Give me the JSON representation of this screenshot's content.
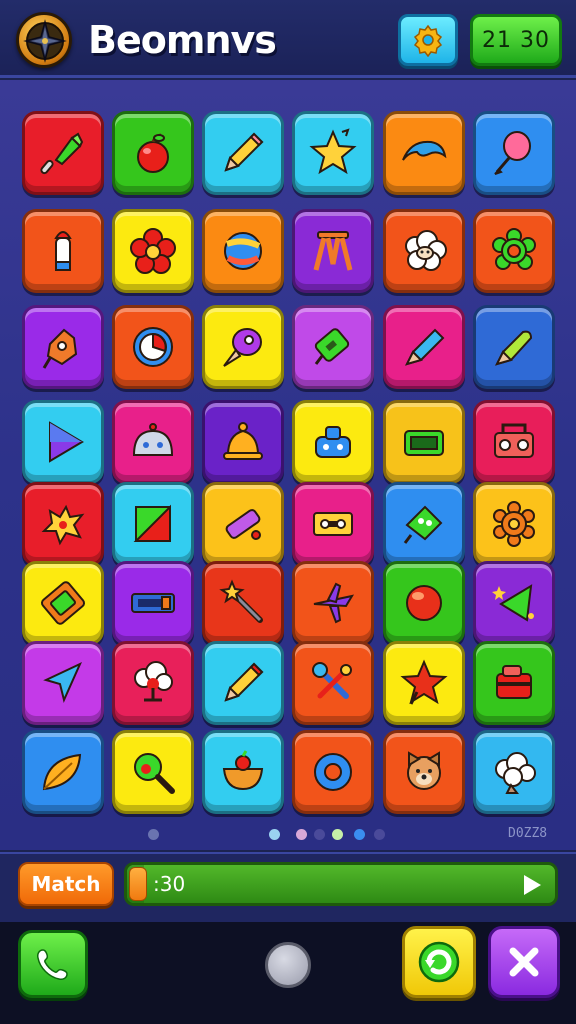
{
  "header": {
    "title": "Beomnvs",
    "timer": "21  30",
    "logo_icon": "compass-icon",
    "settings_icon": "gear-icon"
  },
  "board": {
    "columns": 6,
    "rows": 8,
    "tiles": [
      {
        "color": "#e81e2a",
        "icon": "paintbrush-icon"
      },
      {
        "color": "#35c61c",
        "icon": "apple-icon"
      },
      {
        "color": "#33cdf0",
        "icon": "pencil-icon"
      },
      {
        "color": "#33cdf0",
        "icon": "star-icon"
      },
      {
        "color": "#fb8a12",
        "icon": "wave-icon"
      },
      {
        "color": "#2f8ef0",
        "icon": "balloon-icon"
      },
      {
        "color": "#f2541a",
        "icon": "crayon-icon"
      },
      {
        "color": "#fcea10",
        "icon": "flower-icon"
      },
      {
        "color": "#fb8a12",
        "icon": "ball-icon"
      },
      {
        "color": "#8a2ad6",
        "icon": "easel-icon"
      },
      {
        "color": "#f2541a",
        "icon": "sheep-icon"
      },
      {
        "color": "#f2541a",
        "icon": "gear-flower-icon"
      },
      {
        "color": "#9a2ae8",
        "icon": "robot-icon"
      },
      {
        "color": "#f2541a",
        "icon": "target-icon"
      },
      {
        "color": "#fcea10",
        "icon": "rocket-icon"
      },
      {
        "color": "#c04ae8",
        "icon": "battery-icon"
      },
      {
        "color": "#e8208a",
        "icon": "marker-icon"
      },
      {
        "color": "#2f6ad6",
        "icon": "pen-icon"
      },
      {
        "color": "#33cdf0",
        "icon": "play-triangle-icon"
      },
      {
        "color": "#e8208a",
        "icon": "dome-icon"
      },
      {
        "color": "#6a22c8",
        "icon": "bell-icon"
      },
      {
        "color": "#fcea10",
        "icon": "robot-head-icon"
      },
      {
        "color": "#f7c21a",
        "icon": "radio-icon"
      },
      {
        "color": "#e81e5a",
        "icon": "boombox-icon"
      },
      {
        "color": "#e81e2a",
        "icon": "splat-icon"
      },
      {
        "color": "#33cdf0",
        "icon": "square-slash-icon"
      },
      {
        "color": "#fcc21a",
        "icon": "eraser-icon"
      },
      {
        "color": "#e8208a",
        "icon": "cassette-icon"
      },
      {
        "color": "#2f8ef0",
        "icon": "monster-icon"
      },
      {
        "color": "#fcc21a",
        "icon": "cog-icon"
      },
      {
        "color": "#fcea10",
        "icon": "card-icon"
      },
      {
        "color": "#9a2ae8",
        "icon": "slider-box-icon"
      },
      {
        "color": "#e8361a",
        "icon": "magic-wand-icon"
      },
      {
        "color": "#f2541a",
        "icon": "plane-icon"
      },
      {
        "color": "#35c61c",
        "icon": "orb-icon"
      },
      {
        "color": "#8a2ad6",
        "icon": "sparkle-triangle-icon"
      },
      {
        "color": "#c43ae8",
        "icon": "cursor-arrow-icon"
      },
      {
        "color": "#e8205a",
        "icon": "tree-icon"
      },
      {
        "color": "#33cdf0",
        "icon": "pencil-2-icon"
      },
      {
        "color": "#f2541a",
        "icon": "tools-icon"
      },
      {
        "color": "#fcea10",
        "icon": "red-star-icon"
      },
      {
        "color": "#35c61c",
        "icon": "toolbox-icon"
      },
      {
        "color": "#2f8ef0",
        "icon": "leaf-icon"
      },
      {
        "color": "#fcea10",
        "icon": "magnifier-icon"
      },
      {
        "color": "#33cdf0",
        "icon": "bowl-icon"
      },
      {
        "color": "#f2541a",
        "icon": "ring-icon"
      },
      {
        "color": "#f2541a",
        "icon": "dog-face-icon"
      },
      {
        "color": "#33b8f0",
        "icon": "cloud-icon"
      }
    ]
  },
  "pager": {
    "dots": [
      {
        "color": "#6a74b0"
      },
      {
        "color": "#9ad2f0"
      },
      {
        "color": "#d8a8d8"
      },
      {
        "color": "#4a4a9a"
      },
      {
        "color": "#c6f0a8"
      },
      {
        "color": "#3a8ef0"
      },
      {
        "color": "#4a4a9a"
      }
    ],
    "score_label": "D0ZZ8"
  },
  "action_bar": {
    "match_label": "Match",
    "timer_text": ":30",
    "progress": 0.04,
    "play_icon": "play-icon"
  },
  "nav": {
    "call_icon": "phone-icon",
    "home_icon": "home-circle-icon",
    "refresh_icon": "refresh-icon",
    "close_icon": "close-icon"
  }
}
